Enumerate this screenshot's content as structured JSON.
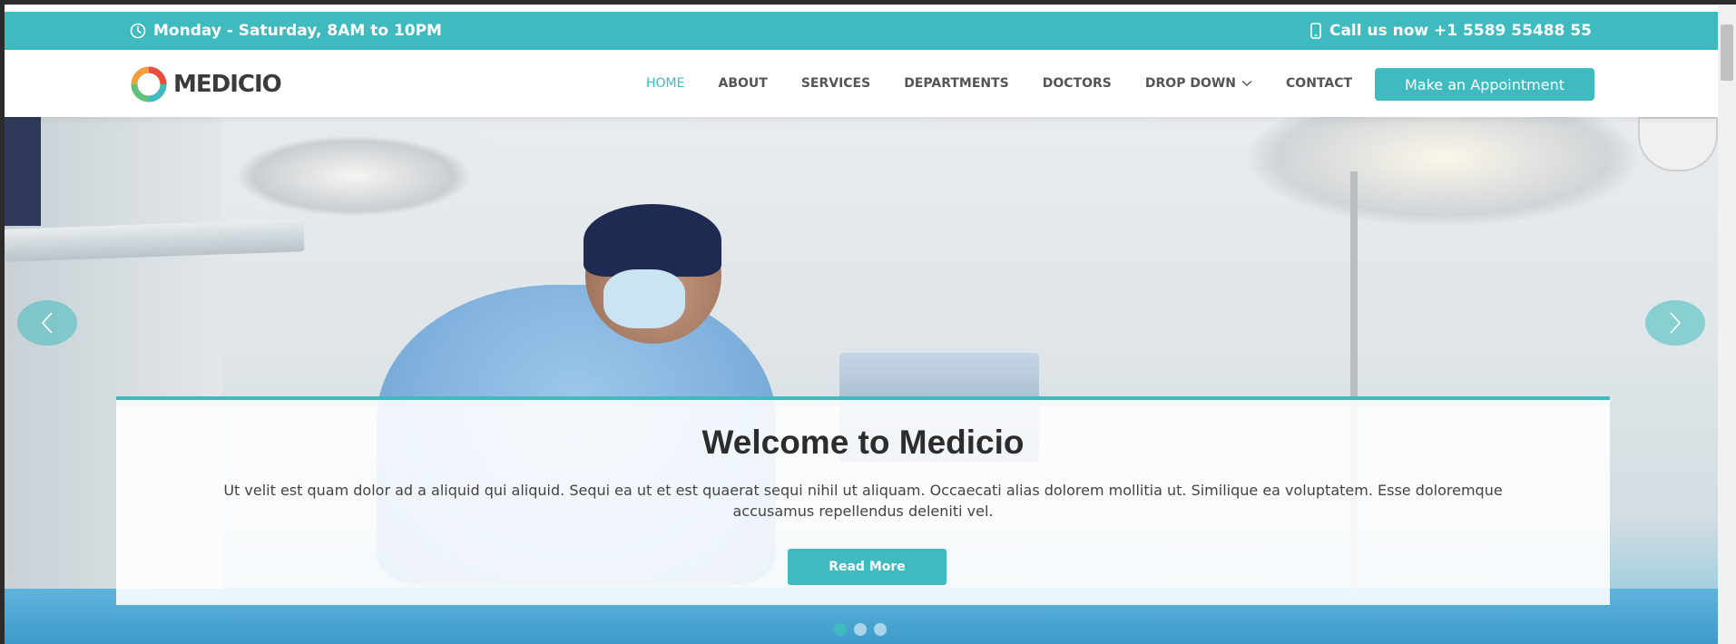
{
  "topbar": {
    "hours": "Monday - Saturday, 8AM to 10PM",
    "phone": "Call us now +1 5589 55488 55"
  },
  "header": {
    "logo_text": "MEDICIO",
    "nav": [
      {
        "label": "HOME",
        "active": true
      },
      {
        "label": "ABOUT"
      },
      {
        "label": "SERVICES"
      },
      {
        "label": "DEPARTMENTS"
      },
      {
        "label": "DOCTORS"
      },
      {
        "label": "DROP DOWN"
      },
      {
        "label": "CONTACT"
      }
    ],
    "appointment_label": "Make an Appointment"
  },
  "hero": {
    "title": "Welcome to Medicio",
    "text": "Ut velit est quam dolor ad a aliquid qui aliquid. Sequi ea ut et est quaerat sequi nihil ut aliquam. Occaecati alias dolorem mollitia ut. Similique ea voluptatem. Esse doloremque accusamus repellendus deleniti vel.",
    "button_label": "Read More",
    "slides": 3,
    "active_slide": 1
  },
  "colors": {
    "accent": "#3fbbc0",
    "text_dark": "#2c2c2c",
    "nav_text": "#555555"
  }
}
